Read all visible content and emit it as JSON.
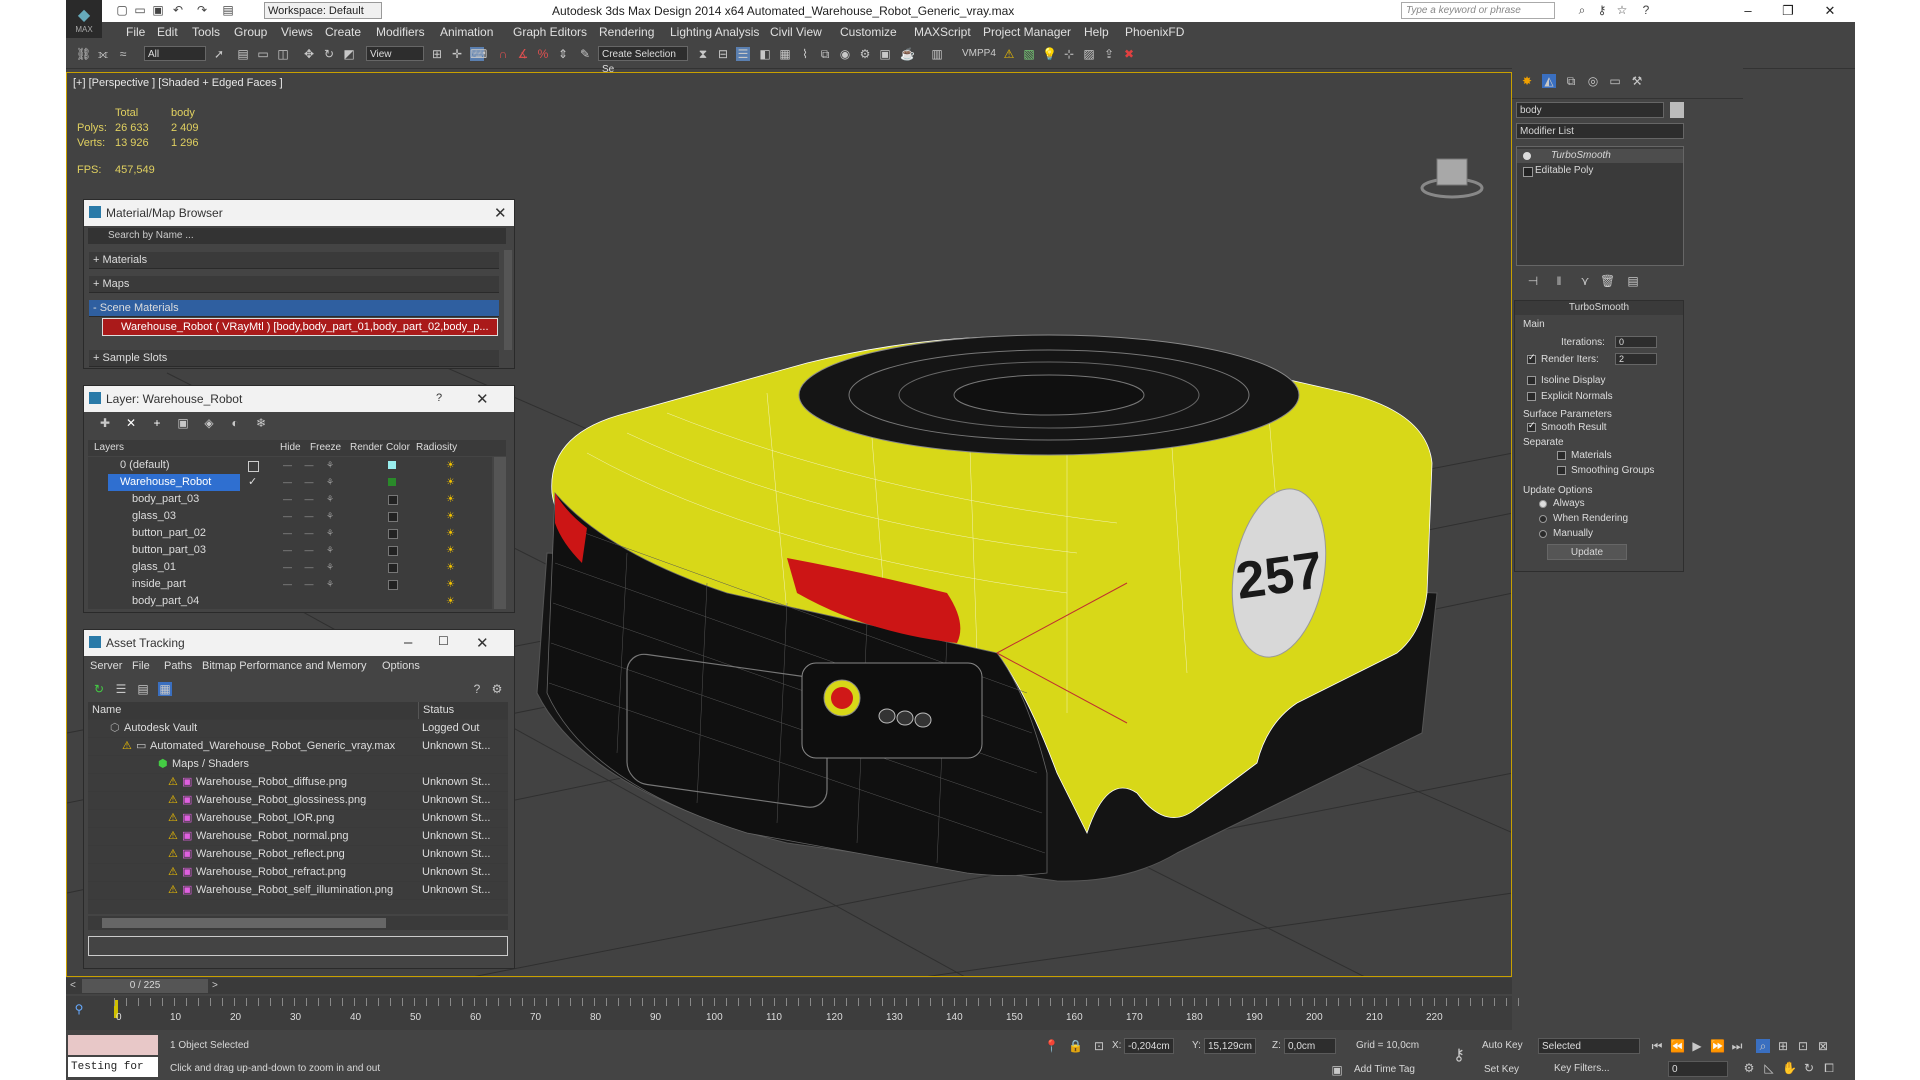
{
  "window": {
    "title": "Autodesk 3ds Max Design 2014 x64     Automated_Warehouse_Robot_Generic_vray.max",
    "workspace": "Workspace: Default",
    "search_placeholder": "Type a keyword or phrase",
    "logo_text": "MAX"
  },
  "menu": [
    "File",
    "Edit",
    "Tools",
    "Group",
    "Views",
    "Create",
    "Modifiers",
    "Animation",
    "Graph Editors",
    "Rendering",
    "Lighting Analysis",
    "Civil View",
    "Customize",
    "MAXScript",
    "Project Manager",
    "Help",
    "PhoenixFD"
  ],
  "toolbar": {
    "filter": "All",
    "ref_coord": "View",
    "selection_set": "Create Selection Se",
    "vmpp": "VMPP4"
  },
  "viewport": {
    "label": "[+] [Perspective ] [Shaded + Edged Faces ]",
    "stats": {
      "col_total": "Total",
      "col_body": "body",
      "polys_label": "Polys:",
      "polys_total": "26 633",
      "polys_body": "2 409",
      "verts_label": "Verts:",
      "verts_total": "13 926",
      "verts_body": "1 296",
      "fps_label": "FPS:",
      "fps_value": "457,549"
    },
    "model_number": "257"
  },
  "material_browser": {
    "title": "Material/Map Browser",
    "search_placeholder": "Search by Name ...",
    "sections": [
      "+ Materials",
      "+ Maps",
      "- Scene Materials"
    ],
    "scene_material": "Warehouse_Robot ( VRayMtl ) [body,body_part_01,body_part_02,body_p...",
    "more": "+ Sample Slots"
  },
  "layer_panel": {
    "title": "Layer: Warehouse_Robot",
    "help": "?",
    "columns": [
      "Layers",
      "Hide",
      "Freeze",
      "Render",
      "Color",
      "Radiosity"
    ],
    "rows": [
      "0 (default)",
      "Warehouse_Robot",
      "body_part_03",
      "glass_03",
      "button_part_02",
      "button_part_03",
      "glass_01",
      "inside_part",
      "body_part_04"
    ]
  },
  "asset_tracking": {
    "title": "Asset Tracking",
    "menu": [
      "Server",
      "File",
      "Paths",
      "Bitmap Performance and Memory",
      "Options"
    ],
    "columns": [
      "Name",
      "Status"
    ],
    "rows": [
      {
        "name": "Autodesk Vault",
        "status": "Logged Out"
      },
      {
        "name": "Automated_Warehouse_Robot_Generic_vray.max",
        "status": "Unknown St..."
      },
      {
        "name": "Maps / Shaders",
        "status": ""
      },
      {
        "name": "Warehouse_Robot_diffuse.png",
        "status": "Unknown St..."
      },
      {
        "name": "Warehouse_Robot_glossiness.png",
        "status": "Unknown St..."
      },
      {
        "name": "Warehouse_Robot_IOR.png",
        "status": "Unknown St..."
      },
      {
        "name": "Warehouse_Robot_normal.png",
        "status": "Unknown St..."
      },
      {
        "name": "Warehouse_Robot_reflect.png",
        "status": "Unknown St..."
      },
      {
        "name": "Warehouse_Robot_refract.png",
        "status": "Unknown St..."
      },
      {
        "name": "Warehouse_Robot_self_illumination.png",
        "status": "Unknown St..."
      }
    ]
  },
  "command_panel": {
    "object_name": "body",
    "modifier_list": "Modifier List",
    "stack": [
      "TurboSmooth",
      "Editable Poly"
    ],
    "rollout_title": "TurboSmooth",
    "main": "Main",
    "iterations_label": "Iterations:",
    "iterations": "0",
    "render_iters_label": "Render Iters:",
    "render_iters": "2",
    "isoline": "Isoline Display",
    "explicit_normals": "Explicit Normals",
    "surface_params": "Surface Parameters",
    "smooth_result": "Smooth Result",
    "separate": "Separate",
    "materials": "Materials",
    "smoothing_groups": "Smoothing Groups",
    "update_options": "Update Options",
    "always": "Always",
    "when_rendering": "When Rendering",
    "manually": "Manually",
    "update_btn": "Update"
  },
  "timeline": {
    "frame": "0 / 225",
    "ticks": [
      "0",
      "10",
      "20",
      "30",
      "40",
      "50",
      "60",
      "70",
      "80",
      "90",
      "100",
      "110",
      "120",
      "130",
      "140",
      "150",
      "160",
      "170",
      "180",
      "190",
      "200",
      "210",
      "220"
    ]
  },
  "status_bar": {
    "script": "Testing for",
    "selected": "1 Object Selected",
    "prompt": "Click and drag up-and-down to zoom in and out",
    "x_label": "X:",
    "x": "-0,204cm",
    "y_label": "Y:",
    "y": "15,129cm",
    "z_label": "Z:",
    "z": "0,0cm",
    "grid": "Grid = 10,0cm",
    "add_time_tag": "Add Time Tag",
    "auto_key": "Auto Key",
    "set_key": "Set Key",
    "selected_dd": "Selected",
    "key_filters": "Key Filters...",
    "frame_field": "0"
  }
}
